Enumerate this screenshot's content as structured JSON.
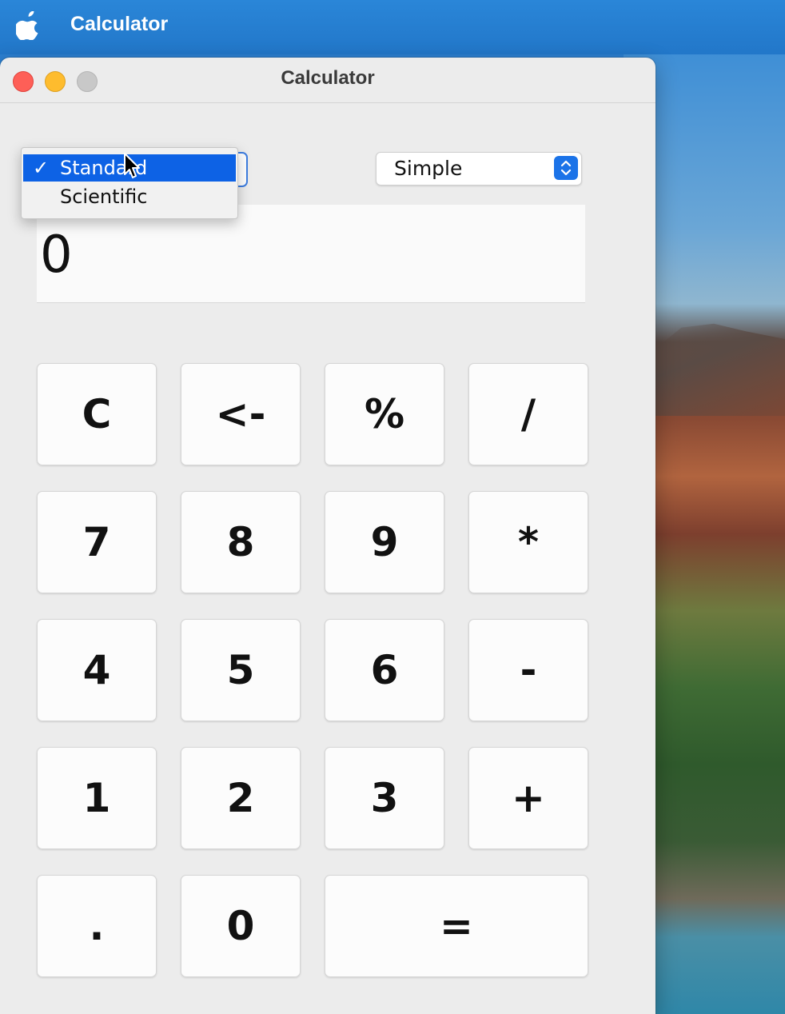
{
  "menubar": {
    "apple_icon": "apple-logo-icon",
    "app_name": "Calculator"
  },
  "window": {
    "title": "Calculator",
    "traffic_lights": [
      "close-button",
      "minimize-button",
      "zoom-button"
    ]
  },
  "mode_select": {
    "options": [
      "Standard",
      "Scientific"
    ],
    "selected": "Standard",
    "checkmark": "✓"
  },
  "style_select": {
    "value": "Simple",
    "stepper_icon": "chevron-up-down-icon"
  },
  "display": {
    "value": "0"
  },
  "keypad": {
    "row1": [
      "C",
      "<-",
      "%",
      "/"
    ],
    "row2": [
      "7",
      "8",
      "9",
      "*"
    ],
    "row3": [
      "4",
      "5",
      "6",
      "-"
    ],
    "row4": [
      "1",
      "2",
      "3",
      "+"
    ],
    "row5": [
      ".",
      "0",
      "="
    ]
  },
  "colors": {
    "menubar": "#2277c9",
    "selection": "#0d62e5",
    "stepper": "#1b73e8",
    "close": "#fe5f57",
    "minimize": "#febc2e",
    "zoom": "#c8c8c8"
  }
}
